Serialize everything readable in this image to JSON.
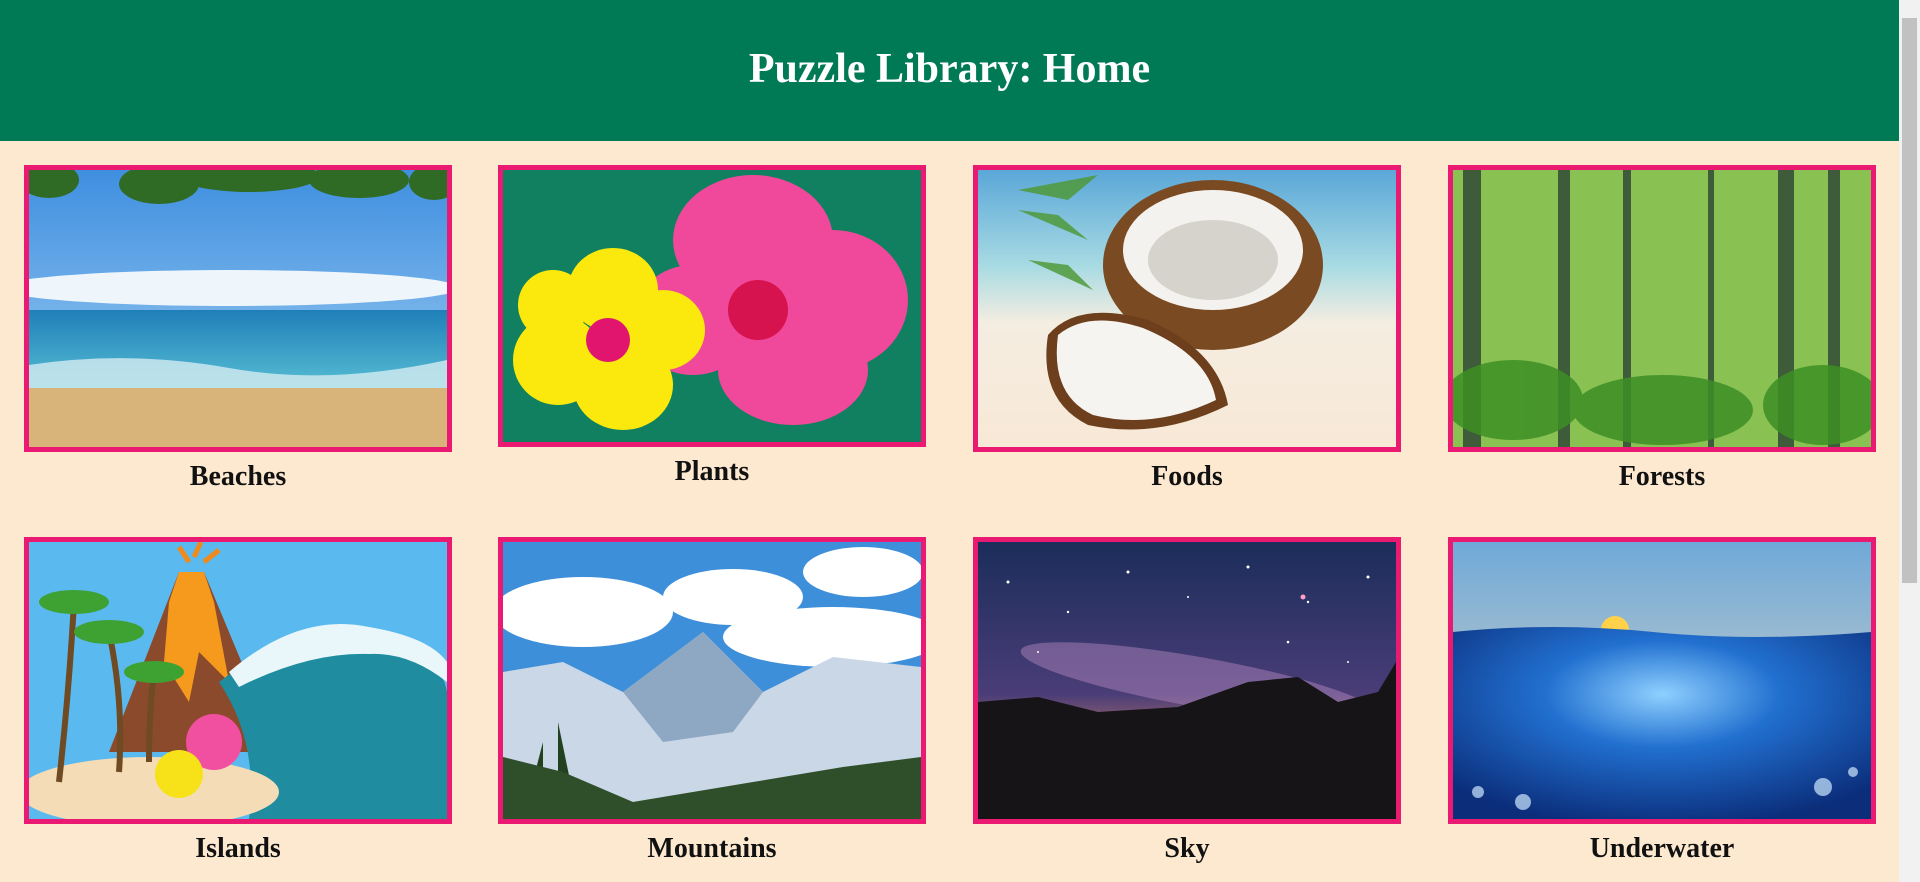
{
  "header": {
    "title": "Puzzle Library: Home"
  },
  "categories": [
    {
      "label": "Beaches"
    },
    {
      "label": "Plants"
    },
    {
      "label": "Foods"
    },
    {
      "label": "Forests"
    },
    {
      "label": "Islands"
    },
    {
      "label": "Mountains"
    },
    {
      "label": "Sky"
    },
    {
      "label": "Underwater"
    }
  ],
  "colors": {
    "header_bg": "#007a55",
    "page_bg": "#fde9cf",
    "frame_border": "#ea1a72"
  }
}
